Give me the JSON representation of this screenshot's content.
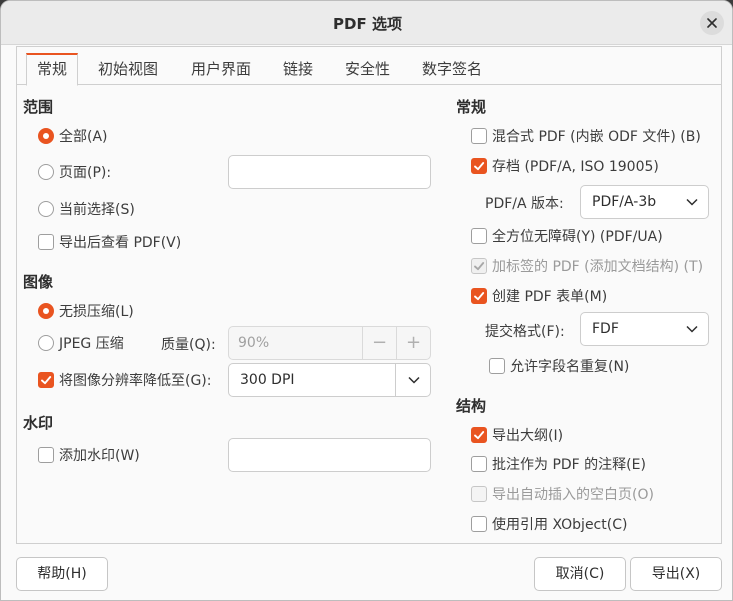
{
  "window": {
    "title": "PDF 选项"
  },
  "tabs": [
    {
      "label": "常规",
      "active": true
    },
    {
      "label": "初始视图"
    },
    {
      "label": "用户界面"
    },
    {
      "label": "链接"
    },
    {
      "label": "安全性"
    },
    {
      "label": "数字签名"
    }
  ],
  "range": {
    "title": "范围",
    "all": "全部(A)",
    "pages": "页面(P):",
    "pages_value": "",
    "selection": "当前选择(S)",
    "view_after": "导出后查看 PDF(V)"
  },
  "images": {
    "title": "图像",
    "lossless": "无损压缩(L)",
    "jpeg": "JPEG 压缩",
    "quality_label": "质量(Q):",
    "quality_value": "90%",
    "reduce": "将图像分辨率降低至(G):",
    "reduce_value": "300 DPI",
    "minus": "−",
    "plus": "+"
  },
  "watermark": {
    "title": "水印",
    "add": "添加水印(W)",
    "value": ""
  },
  "general": {
    "title": "常规",
    "hybrid": "混合式 PDF (内嵌 ODF 文件) (B)",
    "archive": "存档 (PDF/A, ISO 19005)",
    "pdfa_label": "PDF/A 版本:",
    "pdfa_value": "PDF/A-3b",
    "universal": "全方位无障碍(Y) (PDF/UA)",
    "tagged": "加标签的 PDF (添加文档结构) (T)",
    "form": "创建 PDF 表单(M)",
    "submit_label": "提交格式(F):",
    "submit_value": "FDF",
    "dup_names": "允许字段名重复(N)"
  },
  "structure": {
    "title": "结构",
    "outline": "导出大纲(I)",
    "comments": "批注作为 PDF 的注释(E)",
    "blank_pages": "导出自动插入的空白页(O)",
    "xobject": "使用引用 XObject(C)"
  },
  "footer": {
    "help": "帮助(H)",
    "cancel": "取消(C)",
    "export": "导出(X)"
  },
  "colors": {
    "accent": "#e95420"
  }
}
